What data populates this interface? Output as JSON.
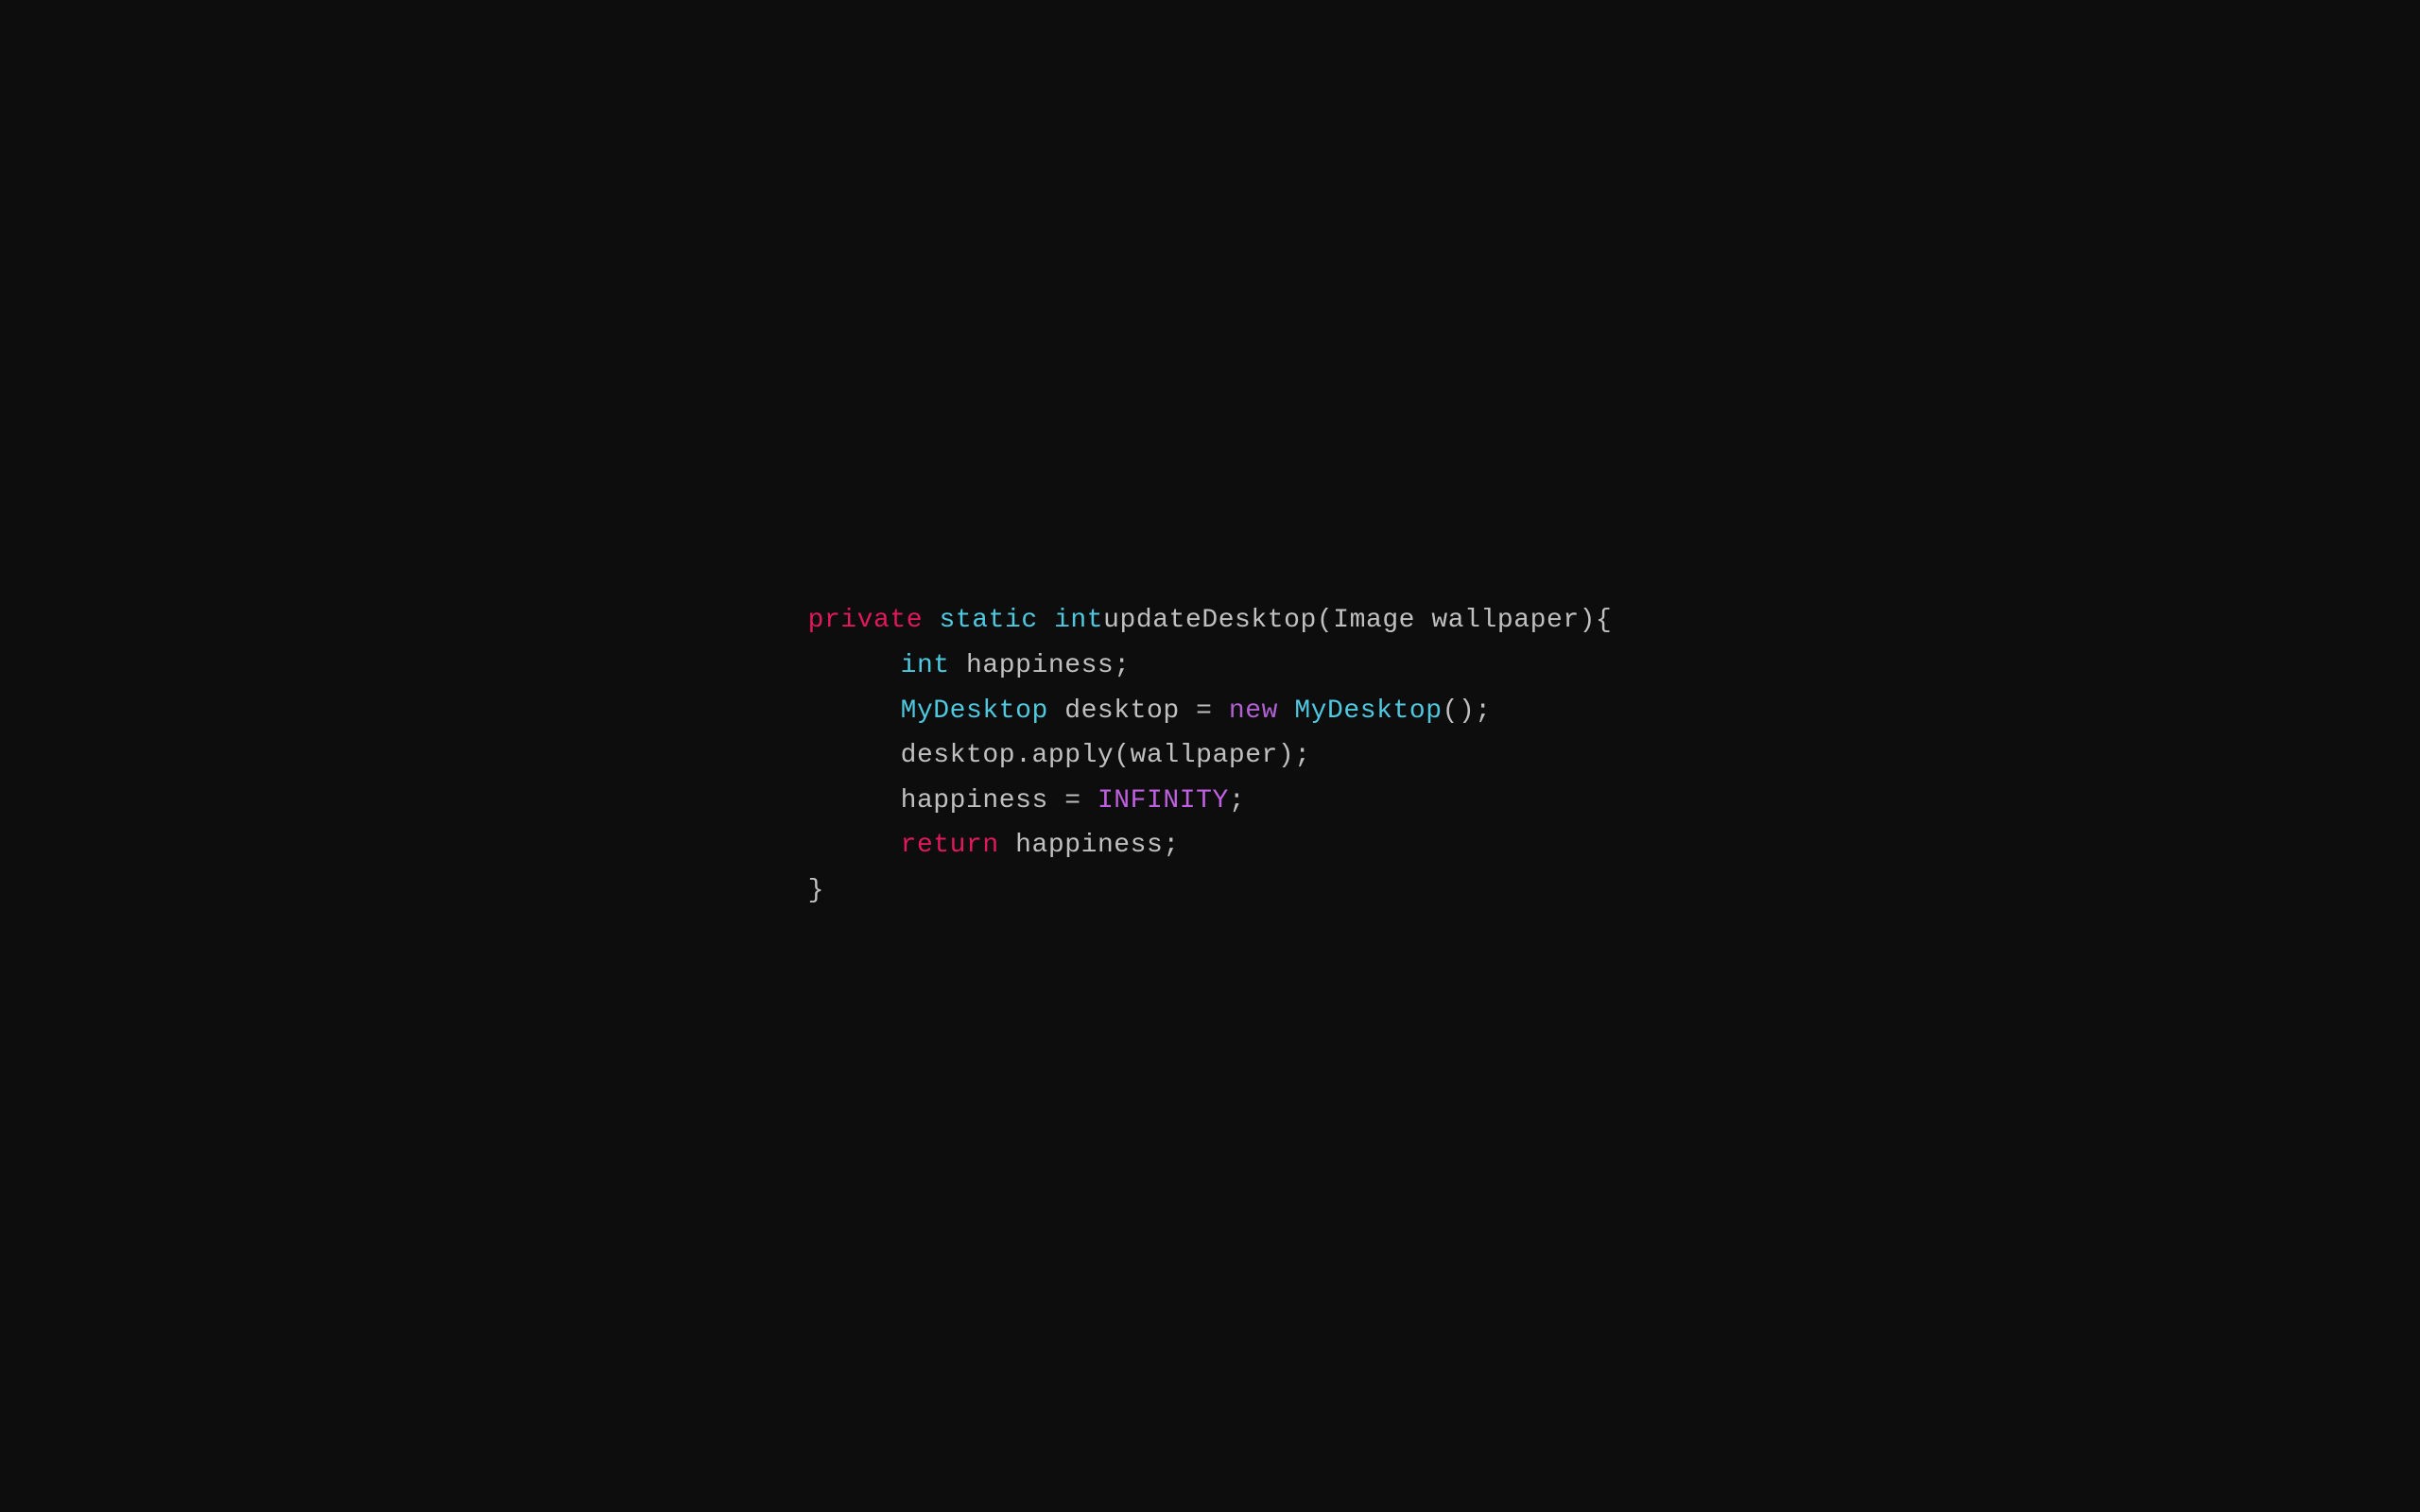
{
  "code": {
    "line1": {
      "private": "private",
      "space1": " ",
      "static": "static",
      "space2": " ",
      "int": "int",
      "space3": " ",
      "rest": "updateDesktop(Image wallpaper){"
    },
    "line2": {
      "int": "int",
      "rest": " happiness;"
    },
    "line3": {
      "mydesktop": "MyDesktop",
      "rest1": " desktop = ",
      "new": "new",
      "rest2": " ",
      "mydesktop2": "MyDesktop",
      "rest3": "();"
    },
    "line4": {
      "text": "desktop.apply(wallpaper);"
    },
    "line5": {
      "text1": "happiness = ",
      "infinity": "INFINITY",
      "text2": ";"
    },
    "line6": {
      "return": "return",
      "rest": " happiness;"
    },
    "line7": {
      "text": "}"
    }
  }
}
